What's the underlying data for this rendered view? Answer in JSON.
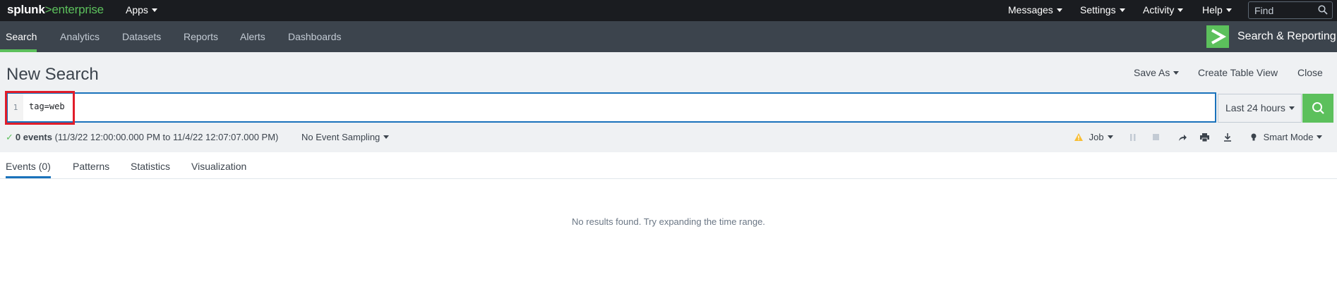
{
  "topbar": {
    "logo": {
      "part1": "splunk",
      "part2": ">enterprise"
    },
    "apps_label": "Apps",
    "messages_label": "Messages",
    "settings_label": "Settings",
    "activity_label": "Activity",
    "help_label": "Help",
    "find_placeholder": "Find"
  },
  "appbar": {
    "nav": [
      "Search",
      "Analytics",
      "Datasets",
      "Reports",
      "Alerts",
      "Dashboards"
    ],
    "app_name": "Search & Reporting"
  },
  "header": {
    "title": "New Search",
    "save_as": "Save As",
    "create_table_view": "Create Table View",
    "close": "Close"
  },
  "search": {
    "line_number": "1",
    "query": "tag=web",
    "time_range": "Last 24 hours"
  },
  "status": {
    "events_count": "0 events",
    "range": "(11/3/22 12:00:00.000 PM to 11/4/22 12:07:07.000 PM)",
    "sampling": "No Event Sampling",
    "job": "Job",
    "mode": "Smart Mode"
  },
  "tabs": [
    "Events (0)",
    "Patterns",
    "Statistics",
    "Visualization"
  ],
  "results": {
    "empty_message": "No results found. Try expanding the time range."
  },
  "colors": {
    "accent_green": "#5cc05c",
    "focus_blue": "#1a72bb",
    "highlight_red": "#e11d2a",
    "topbar": "#1a1c20",
    "appbar": "#3c444d"
  }
}
